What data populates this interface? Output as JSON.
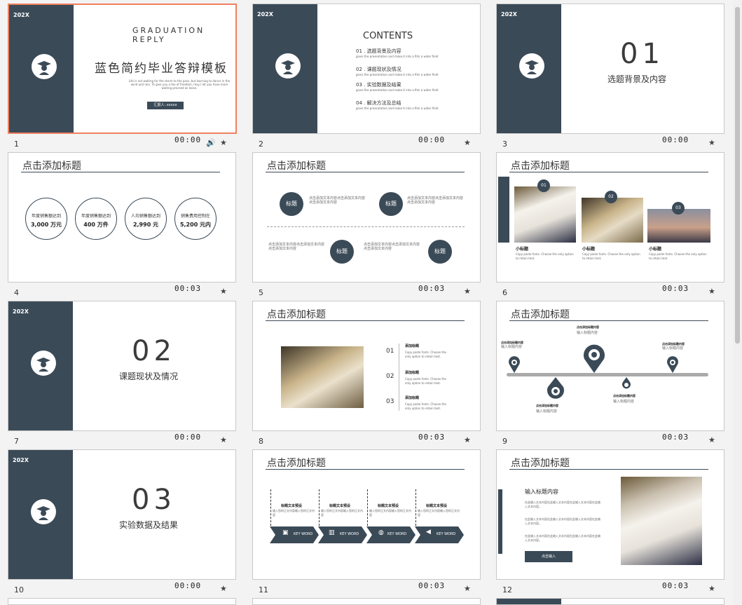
{
  "slides": [
    {
      "num": "1",
      "time": "00:00"
    },
    {
      "num": "2",
      "time": "00:00"
    },
    {
      "num": "3",
      "time": "00:00"
    },
    {
      "num": "4",
      "time": "00:03"
    },
    {
      "num": "5",
      "time": "00:03"
    },
    {
      "num": "6",
      "time": "00:03"
    },
    {
      "num": "7",
      "time": "00:00"
    },
    {
      "num": "8",
      "time": "00:03"
    },
    {
      "num": "9",
      "time": "00:03"
    },
    {
      "num": "10",
      "time": "00:00"
    },
    {
      "num": "11",
      "time": "00:03"
    },
    {
      "num": "12",
      "time": "00:03"
    }
  ],
  "tag": "202X",
  "s1": {
    "eyebrow": "GRADUATION REPLY",
    "title": "蓝色简约毕业答辩模板",
    "body": "Life is not waiting for the storm to the pass, but learning to dance in the wind and rain. To give you a fee of freedom, may I let you have more waiting proceed as loose.",
    "button": "汇报人: xxxxx"
  },
  "s2": {
    "title": "CONTENTS",
    "items": [
      {
        "label": "01 . 选题背景及内容",
        "sub": "gives the presentation and make it into a film a wider field"
      },
      {
        "label": "02 . 课题现状及情况",
        "sub": "gives the presentation and make it into a film a wider field"
      },
      {
        "label": "03 . 实验数据及结果",
        "sub": "gives the presentation and make it into a film a wider field"
      },
      {
        "label": "04 . 解决方法及总结",
        "sub": "gives the presentation and make it into a film a wider field"
      }
    ]
  },
  "s3": {
    "num": "01",
    "sub": "选题背景及内容"
  },
  "s7": {
    "num": "02",
    "sub": "课题现状及情况"
  },
  "s10": {
    "num": "03",
    "sub": "实验数据及结果"
  },
  "common_title": "点击添加标题",
  "s4": {
    "stats": [
      {
        "label": "年度销售额达到",
        "value": "3,000 万元"
      },
      {
        "label": "年度销售额达到",
        "value": "400 万件"
      },
      {
        "label": "人均销售额达到",
        "value": "2,990 元"
      },
      {
        "label": "销售费用控制在",
        "value": "5,200 元内"
      }
    ]
  },
  "s5": {
    "bubble": "标题",
    "filler": "点击添加文本内容点击添加文本内容点击添加文本内容"
  },
  "s6": {
    "tags": [
      "01",
      "02",
      "03"
    ],
    "caption": "小标题",
    "desc": "Copy paste fonts. Choose the only option to retain text."
  },
  "s8": {
    "nums": [
      "01",
      "02",
      "03"
    ],
    "head": "添加标题",
    "desc": "Copy paste fonts. Choose the only option to retain text."
  },
  "s9": {
    "label": "点击添加标题内容",
    "sub": "输入标题内容"
  },
  "s11": {
    "head": "标题文本预设",
    "body": "输入您的正文内容输入您的正文内容",
    "keyword": "KEY WORD"
  },
  "s12": {
    "head": "输入标题内容",
    "para": "在此输入文本内容在此输入文本内容在此输入文本内容在此输入文本内容。",
    "button": "点击输入"
  },
  "icons": {
    "sound": "speaker-icon",
    "star": "star-icon"
  }
}
